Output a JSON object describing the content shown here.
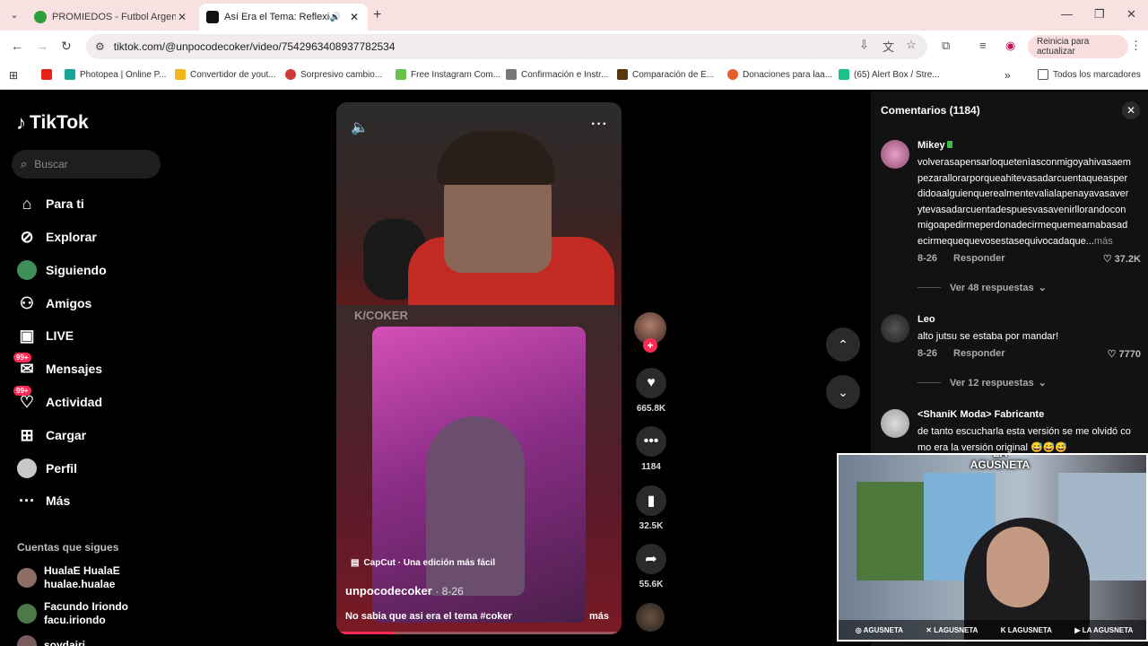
{
  "browser": {
    "tabs": [
      {
        "title": "PROMIEDOS - Futbol Argentino",
        "active": false
      },
      {
        "title": "Así Era el Tema: Reflexiones",
        "active": true
      }
    ],
    "url": "tiktok.com/@unpocodecoker/video/7542963408937782534",
    "relaunch_label": "Reinicia para actualizar",
    "bookmarks": [
      "Photopea | Online P...",
      "Convertidor de yout...",
      "Sorpresivo cambio...",
      "Free Instagram Com...",
      "Confirmación e Instr...",
      "Comparación de E...",
      "Donaciones para laa...",
      "(65) Alert Box / Stre..."
    ],
    "all_bookmarks": "Todos los marcadores"
  },
  "tiktok": {
    "logo": "TikTok",
    "search_placeholder": "Buscar",
    "nav": [
      {
        "label": "Para ti",
        "icon": "home-icon"
      },
      {
        "label": "Explorar",
        "icon": "compass-icon"
      },
      {
        "label": "Siguiendo",
        "icon": "following-avatar-icon"
      },
      {
        "label": "Amigos",
        "icon": "friends-icon"
      },
      {
        "label": "LIVE",
        "icon": "live-icon"
      },
      {
        "label": "Mensajes",
        "icon": "messages-icon",
        "badge": "99+"
      },
      {
        "label": "Actividad",
        "icon": "activity-icon",
        "badge": "99+"
      },
      {
        "label": "Cargar",
        "icon": "upload-icon"
      },
      {
        "label": "Perfil",
        "icon": "profile-icon"
      },
      {
        "label": "Más",
        "icon": "more-icon"
      }
    ],
    "following_header": "Cuentas que sigues",
    "following": [
      {
        "name": "HualaE HualaE",
        "handle": "hualae.hualae"
      },
      {
        "name": "Facundo Iriondo",
        "handle": "facu.iriondo"
      },
      {
        "name": "soydairi",
        "handle": ""
      }
    ]
  },
  "video": {
    "watermark": "K/COKER",
    "capcut": "CapCut · Una edición más fácil",
    "author": "unpocodecoker",
    "date": "8-26",
    "caption": "No sabia que asi era el tema #coker",
    "more": "más",
    "progress": 0.2,
    "likes": "665.8K",
    "comments": "1184",
    "saves": "32.5K",
    "shares": "55.6K"
  },
  "comments_panel": {
    "title": "Comentarios (1184)",
    "items": [
      {
        "user": "Mikey",
        "text": "volverasapensarloquetenìasconmigoyahivasaempezarallorarporqueahitevasadarcuentaqueasperdidoaalguienquerealmentevalialapenayavasaverytevasadarcuentadespuesvasavenirllorandoconmigoapedirmeperdonadecirmequemeamabasadecirmequequevosestasequivocadaque...",
        "more": "más",
        "date": "8-26",
        "reply": "Responder",
        "likes": "37.2K",
        "view_replies": "Ver 48 respuestas"
      },
      {
        "user": "Leo",
        "text": "alto jutsu se estaba por mandar!",
        "date": "8-26",
        "reply": "Responder",
        "likes": "7770",
        "view_replies": "Ver 12 respuestas"
      },
      {
        "user": "<ShaniK Moda> Fabricante",
        "text": "de tanto escucharla esta versión se me olvidó como era la versión original 😅😅😅"
      }
    ]
  },
  "facecam": {
    "logo": "LA AGUSNETA",
    "socials": [
      "AGUSNETA",
      "LAGUSNETA",
      "LAGUSNETA",
      "LA AGUSNETA"
    ]
  }
}
